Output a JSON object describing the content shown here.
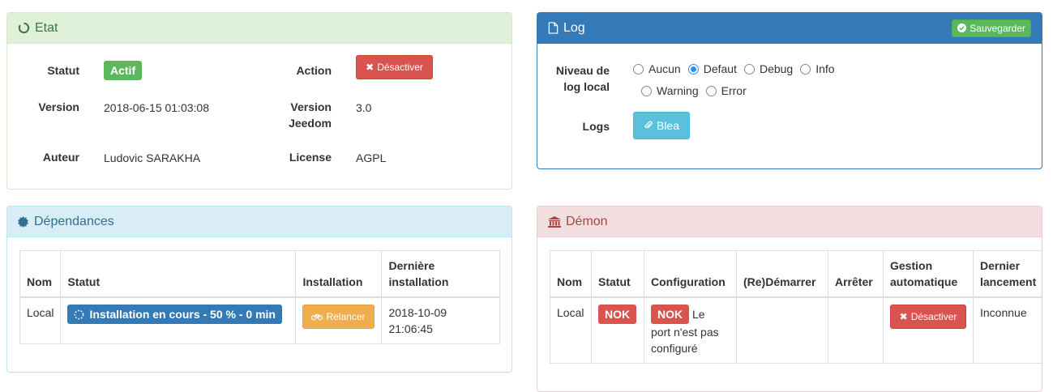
{
  "etat": {
    "title": "Etat",
    "statut_label": "Statut",
    "statut_value": "Actif",
    "action_label": "Action",
    "action_button": "Désactiver",
    "version_label": "Version",
    "version_value": "2018-06-15 01:03:08",
    "version_jeedom_label_1": "Version",
    "version_jeedom_label_2": "Jeedom",
    "version_jeedom_value": "3.0",
    "auteur_label": "Auteur",
    "auteur_value": "Ludovic SARAKHA",
    "license_label": "License",
    "license_value": "AGPL"
  },
  "log": {
    "title": "Log",
    "save_button": "Sauvegarder",
    "niveau_label_1": "Niveau de",
    "niveau_label_2": "log local",
    "options": [
      "Aucun",
      "Defaut",
      "Debug",
      "Info",
      "Warning",
      "Error"
    ],
    "selected": "Defaut",
    "logs_label": "Logs",
    "logs_button": "Blea"
  },
  "dependances": {
    "title": "Dépendances",
    "headers": [
      "Nom",
      "Statut",
      "Installation",
      "Dernière installation"
    ],
    "row": {
      "nom": "Local",
      "statut": "Installation en cours - 50 % - 0 min",
      "installation_button": "Relancer",
      "derniere_1": "2018-10-09",
      "derniere_2": "21:06:45"
    }
  },
  "demon": {
    "title": "Démon",
    "headers": [
      "Nom",
      "Statut",
      "Configuration",
      "(Re)Démarrer",
      "Arrêter",
      "Gestion automatique",
      "Dernier lancement"
    ],
    "row": {
      "nom": "Local",
      "statut": "NOK",
      "config_badge": "NOK",
      "config_text_1": "Le",
      "config_text_2": "port n'est pas",
      "config_text_3": "configuré",
      "gestion_button": "Désactiver",
      "dernier": "Inconnue"
    }
  },
  "colors": {
    "success": "#5cb85c",
    "danger": "#d9534f",
    "primary": "#337ab7",
    "info": "#5bc0de",
    "warning": "#f0ad4e"
  }
}
